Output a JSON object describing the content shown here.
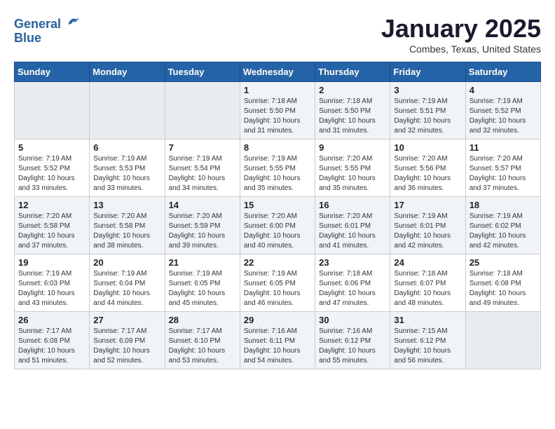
{
  "logo": {
    "line1": "General",
    "line2": "Blue"
  },
  "title": "January 2025",
  "subtitle": "Combes, Texas, United States",
  "days_of_week": [
    "Sunday",
    "Monday",
    "Tuesday",
    "Wednesday",
    "Thursday",
    "Friday",
    "Saturday"
  ],
  "weeks": [
    [
      {
        "day": "",
        "info": ""
      },
      {
        "day": "",
        "info": ""
      },
      {
        "day": "",
        "info": ""
      },
      {
        "day": "1",
        "info": "Sunrise: 7:18 AM\nSunset: 5:50 PM\nDaylight: 10 hours\nand 31 minutes."
      },
      {
        "day": "2",
        "info": "Sunrise: 7:18 AM\nSunset: 5:50 PM\nDaylight: 10 hours\nand 31 minutes."
      },
      {
        "day": "3",
        "info": "Sunrise: 7:19 AM\nSunset: 5:51 PM\nDaylight: 10 hours\nand 32 minutes."
      },
      {
        "day": "4",
        "info": "Sunrise: 7:19 AM\nSunset: 5:52 PM\nDaylight: 10 hours\nand 32 minutes."
      }
    ],
    [
      {
        "day": "5",
        "info": "Sunrise: 7:19 AM\nSunset: 5:52 PM\nDaylight: 10 hours\nand 33 minutes."
      },
      {
        "day": "6",
        "info": "Sunrise: 7:19 AM\nSunset: 5:53 PM\nDaylight: 10 hours\nand 33 minutes."
      },
      {
        "day": "7",
        "info": "Sunrise: 7:19 AM\nSunset: 5:54 PM\nDaylight: 10 hours\nand 34 minutes."
      },
      {
        "day": "8",
        "info": "Sunrise: 7:19 AM\nSunset: 5:55 PM\nDaylight: 10 hours\nand 35 minutes."
      },
      {
        "day": "9",
        "info": "Sunrise: 7:20 AM\nSunset: 5:55 PM\nDaylight: 10 hours\nand 35 minutes."
      },
      {
        "day": "10",
        "info": "Sunrise: 7:20 AM\nSunset: 5:56 PM\nDaylight: 10 hours\nand 36 minutes."
      },
      {
        "day": "11",
        "info": "Sunrise: 7:20 AM\nSunset: 5:57 PM\nDaylight: 10 hours\nand 37 minutes."
      }
    ],
    [
      {
        "day": "12",
        "info": "Sunrise: 7:20 AM\nSunset: 5:58 PM\nDaylight: 10 hours\nand 37 minutes."
      },
      {
        "day": "13",
        "info": "Sunrise: 7:20 AM\nSunset: 5:58 PM\nDaylight: 10 hours\nand 38 minutes."
      },
      {
        "day": "14",
        "info": "Sunrise: 7:20 AM\nSunset: 5:59 PM\nDaylight: 10 hours\nand 39 minutes."
      },
      {
        "day": "15",
        "info": "Sunrise: 7:20 AM\nSunset: 6:00 PM\nDaylight: 10 hours\nand 40 minutes."
      },
      {
        "day": "16",
        "info": "Sunrise: 7:20 AM\nSunset: 6:01 PM\nDaylight: 10 hours\nand 41 minutes."
      },
      {
        "day": "17",
        "info": "Sunrise: 7:19 AM\nSunset: 6:01 PM\nDaylight: 10 hours\nand 42 minutes."
      },
      {
        "day": "18",
        "info": "Sunrise: 7:19 AM\nSunset: 6:02 PM\nDaylight: 10 hours\nand 42 minutes."
      }
    ],
    [
      {
        "day": "19",
        "info": "Sunrise: 7:19 AM\nSunset: 6:03 PM\nDaylight: 10 hours\nand 43 minutes."
      },
      {
        "day": "20",
        "info": "Sunrise: 7:19 AM\nSunset: 6:04 PM\nDaylight: 10 hours\nand 44 minutes."
      },
      {
        "day": "21",
        "info": "Sunrise: 7:19 AM\nSunset: 6:05 PM\nDaylight: 10 hours\nand 45 minutes."
      },
      {
        "day": "22",
        "info": "Sunrise: 7:19 AM\nSunset: 6:05 PM\nDaylight: 10 hours\nand 46 minutes."
      },
      {
        "day": "23",
        "info": "Sunrise: 7:18 AM\nSunset: 6:06 PM\nDaylight: 10 hours\nand 47 minutes."
      },
      {
        "day": "24",
        "info": "Sunrise: 7:18 AM\nSunset: 6:07 PM\nDaylight: 10 hours\nand 48 minutes."
      },
      {
        "day": "25",
        "info": "Sunrise: 7:18 AM\nSunset: 6:08 PM\nDaylight: 10 hours\nand 49 minutes."
      }
    ],
    [
      {
        "day": "26",
        "info": "Sunrise: 7:17 AM\nSunset: 6:08 PM\nDaylight: 10 hours\nand 51 minutes."
      },
      {
        "day": "27",
        "info": "Sunrise: 7:17 AM\nSunset: 6:09 PM\nDaylight: 10 hours\nand 52 minutes."
      },
      {
        "day": "28",
        "info": "Sunrise: 7:17 AM\nSunset: 6:10 PM\nDaylight: 10 hours\nand 53 minutes."
      },
      {
        "day": "29",
        "info": "Sunrise: 7:16 AM\nSunset: 6:11 PM\nDaylight: 10 hours\nand 54 minutes."
      },
      {
        "day": "30",
        "info": "Sunrise: 7:16 AM\nSunset: 6:12 PM\nDaylight: 10 hours\nand 55 minutes."
      },
      {
        "day": "31",
        "info": "Sunrise: 7:15 AM\nSunset: 6:12 PM\nDaylight: 10 hours\nand 56 minutes."
      },
      {
        "day": "",
        "info": ""
      }
    ]
  ]
}
